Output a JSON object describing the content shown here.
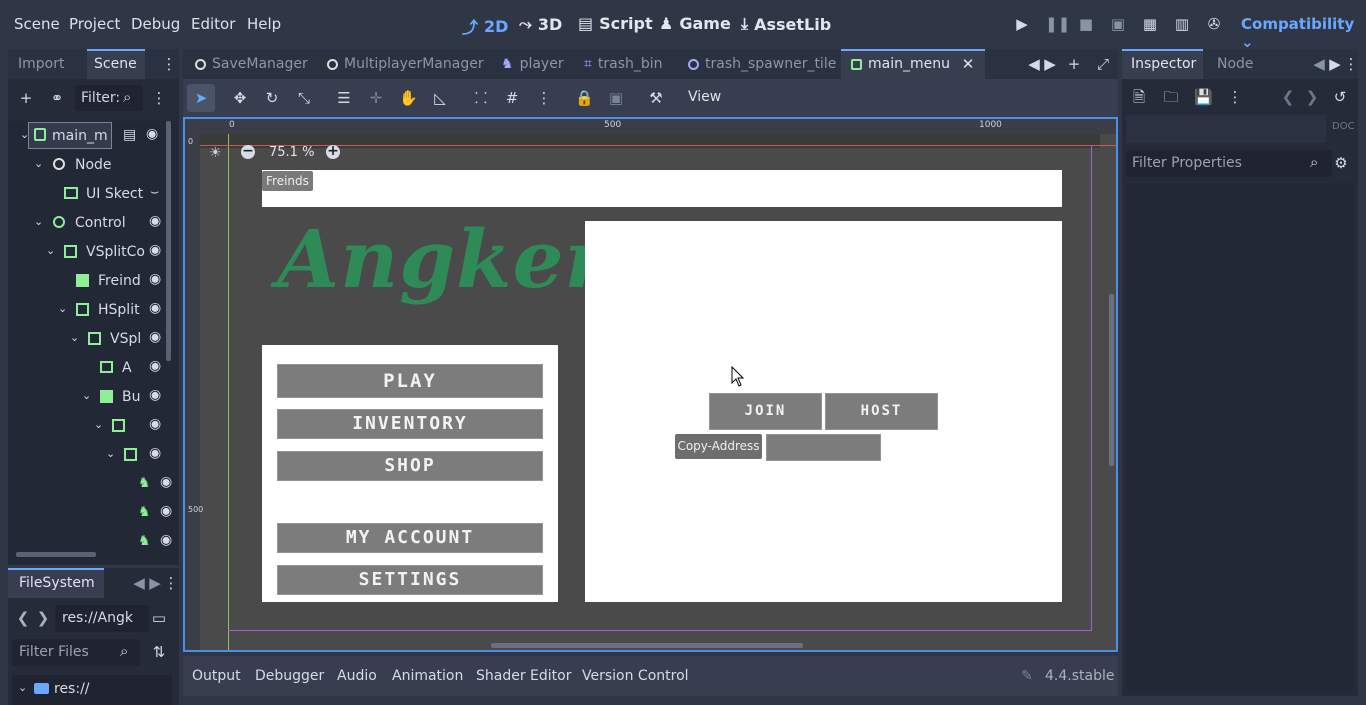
{
  "menubar": {
    "items": [
      "Scene",
      "Project",
      "Debug",
      "Editor",
      "Help"
    ],
    "modes": [
      "2D",
      "3D",
      "Script",
      "Game",
      "AssetLib"
    ],
    "renderer": "Compatibility"
  },
  "left_dock": {
    "tabs": [
      "Import",
      "Scene"
    ],
    "filter_placeholder": "Filter:",
    "tree": [
      {
        "label": "main_m",
        "icon": "control-icon"
      },
      {
        "label": "Node",
        "icon": "node-icon"
      },
      {
        "label": "UI Skect",
        "icon": "texture-rect-icon"
      },
      {
        "label": "Control",
        "icon": "control-icon"
      },
      {
        "label": "VSplitCo",
        "icon": "vsplit-icon"
      },
      {
        "label": "Freind",
        "icon": "texture-rect-icon"
      },
      {
        "label": "HSplit",
        "icon": "hsplit-icon"
      },
      {
        "label": "VSpl",
        "icon": "vsplit-icon"
      },
      {
        "label": "A",
        "icon": "texture-rect-icon"
      },
      {
        "label": "Bu",
        "icon": "texture-rect-icon"
      },
      {
        "label": "",
        "icon": "control-icon"
      },
      {
        "label": "",
        "icon": "vbox-icon"
      },
      {
        "label": "",
        "icon": "button-icon"
      },
      {
        "label": "",
        "icon": "button-icon"
      },
      {
        "label": "",
        "icon": "button-icon"
      }
    ]
  },
  "filesystem": {
    "title": "FileSystem",
    "path": "res://Angk",
    "filter_placeholder": "Filter Files",
    "root": "res://"
  },
  "scene_tabs": [
    "SaveManager",
    "MultiplayerManager",
    "player",
    "trash_bin",
    "trash_spawner_tile",
    "main_menu"
  ],
  "toolbar": {
    "view_label": "View"
  },
  "canvas": {
    "zoom": "75.1 %",
    "ruler_marks": [
      "0",
      "500",
      "1000"
    ],
    "vruler_marks": [
      "0",
      "500"
    ],
    "game": {
      "friends_label": "Freinds",
      "logo_text": "Angker",
      "menu_buttons": [
        "PLAY",
        "INVENTORY",
        "SHOP",
        "MY ACCOUNT",
        "SETTINGS"
      ],
      "join_label": "JOIN",
      "host_label": "HOST",
      "copy_address_label": "Copy-Address"
    }
  },
  "bottom_panel": {
    "tabs": [
      "Output",
      "Debugger",
      "Audio",
      "Animation",
      "Shader Editor",
      "Version Control"
    ],
    "version": "4.4.stable"
  },
  "inspector": {
    "tabs": [
      "Inspector",
      "Node"
    ],
    "filter_placeholder": "Filter Properties"
  },
  "colors": {
    "accent": "#6aa8ff",
    "node_green": "#8eef97",
    "logo_green": "#2e8b57"
  }
}
